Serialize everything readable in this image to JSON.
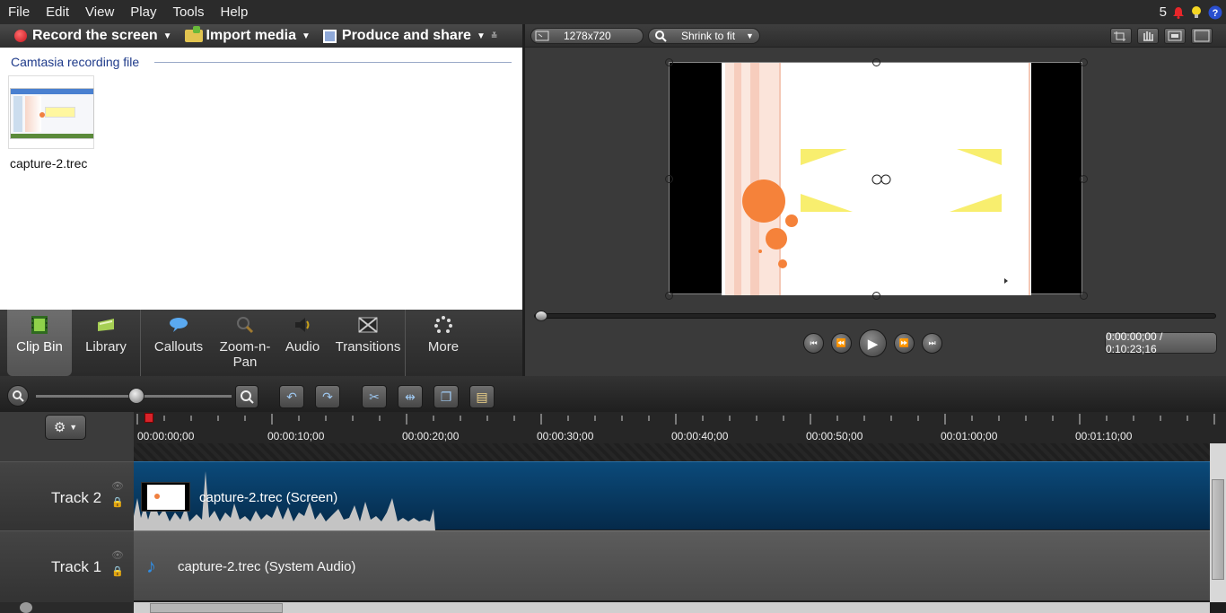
{
  "menubar": {
    "items": [
      "File",
      "Edit",
      "View",
      "Play",
      "Tools",
      "Help"
    ],
    "notification_count": "5"
  },
  "record_toolbar": {
    "record_label": "Record the screen",
    "import_label": "Import media",
    "produce_label": "Produce and share"
  },
  "clip_bin": {
    "section_title": "Camtasia recording file",
    "clip_name": "capture-2.trec"
  },
  "tabs": {
    "clip_bin": "Clip Bin",
    "library": "Library",
    "callouts": "Callouts",
    "zoom_n_pan": "Zoom-n-\nPan",
    "audio": "Audio",
    "transitions": "Transitions",
    "more": "More"
  },
  "preview": {
    "dimensions": "1278x720",
    "fit_mode": "Shrink to fit",
    "timecode": "0:00:00;00 / 0:10:23;16"
  },
  "timeline": {
    "ruler_labels": [
      "00:00:00;00",
      "00:00:10;00",
      "00:00:20;00",
      "00:00:30;00",
      "00:00:40;00",
      "00:00:50;00",
      "00:01:00;00",
      "00:01:10;00"
    ],
    "tracks": [
      {
        "name": "Track 2",
        "clip_title": "capture-2.trec (Screen)"
      },
      {
        "name": "Track 1",
        "clip_title": "capture-2.trec (System Audio)"
      }
    ]
  },
  "colors": {
    "accent_blue": "#0b4a7a",
    "record_red": "#c4121d",
    "playhead_red": "#d8232a"
  }
}
